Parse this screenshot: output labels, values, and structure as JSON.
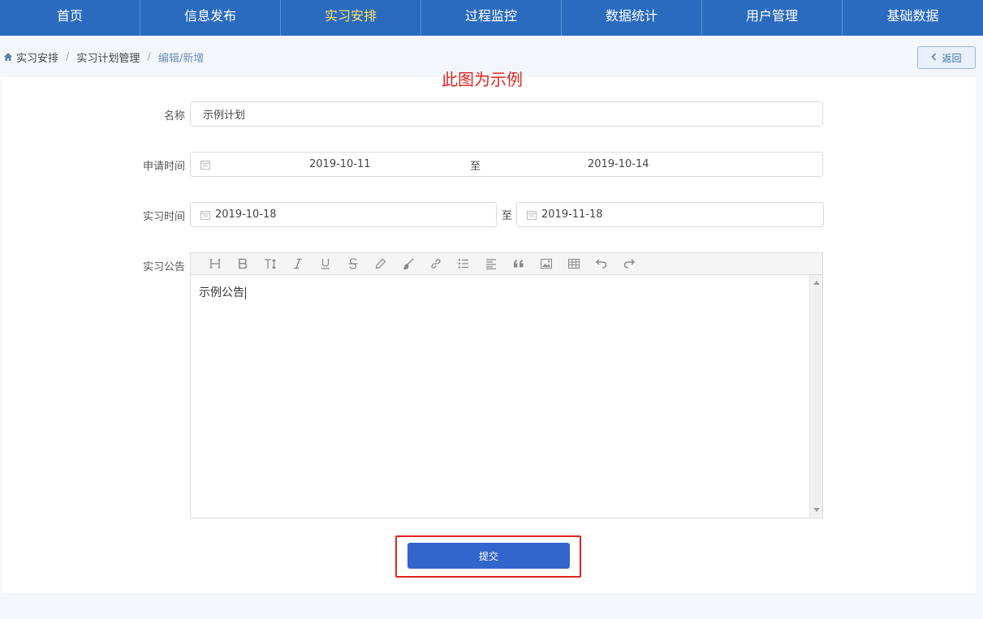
{
  "nav": {
    "items": [
      {
        "label": "首页"
      },
      {
        "label": "信息发布"
      },
      {
        "label": "实习安排"
      },
      {
        "label": "过程监控"
      },
      {
        "label": "数据统计"
      },
      {
        "label": "用户管理"
      },
      {
        "label": "基础数据"
      }
    ],
    "active_color": "#ffe26a",
    "bar_color": "#2b6bbf"
  },
  "breadcrumb": {
    "items": [
      "实习安排",
      "实习计划管理",
      "编辑/新增"
    ],
    "separator": "/"
  },
  "back_button": {
    "label": "返回"
  },
  "note": "此图为示例",
  "form": {
    "name": {
      "label": "名称",
      "value": "示例计划"
    },
    "apply_time": {
      "label": "申请时间",
      "start": "2019-10-11",
      "to": "至",
      "end": "2019-10-14"
    },
    "intern_time": {
      "label": "实习时间",
      "start": "2019-10-18",
      "to": "至",
      "end": "2019-11-18"
    },
    "notice": {
      "label": "实习公告",
      "content": "示例公告"
    }
  },
  "toolbar_icons": [
    "heading-icon",
    "bold-icon",
    "text-size-icon",
    "italic-icon",
    "underline-icon",
    "strikethrough-icon",
    "highlight-icon",
    "brush-icon",
    "link-icon",
    "list-icon",
    "align-icon",
    "quote-icon",
    "image-icon",
    "table-icon",
    "undo-icon",
    "redo-icon"
  ],
  "submit": {
    "label": "提交",
    "color": "#3366cc"
  },
  "highlight_color": "#e0261f"
}
